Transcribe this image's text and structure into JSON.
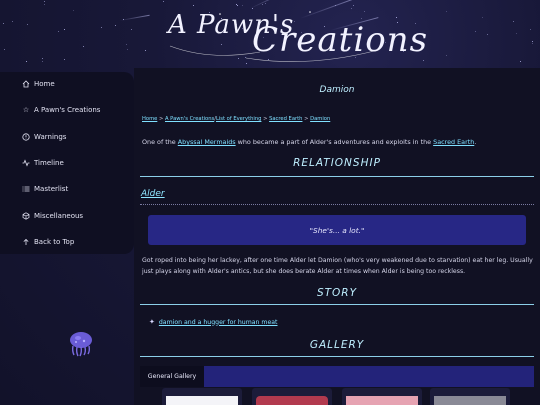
{
  "header": {
    "logo_text_a": "A Pawn's",
    "logo_text_b": "Creations"
  },
  "sidebar": {
    "items": [
      {
        "label": "Home",
        "icon": "home-icon"
      },
      {
        "label": "A Pawn's Creations",
        "icon": "star-outline-icon"
      },
      {
        "label": "Warnings",
        "icon": "warning-circle-icon"
      },
      {
        "label": "Timeline",
        "icon": "activity-icon"
      },
      {
        "label": "Masterlist",
        "icon": "list-icon"
      },
      {
        "label": "Miscellaneous",
        "icon": "cube-icon"
      },
      {
        "label": "Back to Top",
        "icon": "arrow-up-icon"
      }
    ]
  },
  "main": {
    "title": "Damion",
    "breadcrumb": {
      "home": "Home",
      "sep": " > ",
      "creations": "A Pawn's Creations",
      "slash": "/",
      "list": "List of Everything",
      "sacred": "Sacred Earth",
      "current": "Damion"
    },
    "intro": {
      "pre": "One of the ",
      "link1": "Abyssal Mermaids",
      "mid": " who became a part of Alder's adventures and exploits in the ",
      "link2": "Sacred Earth",
      "post": "."
    },
    "relationship_heading": "RELATIONSHIP",
    "relation_name": "Alder",
    "quote": "\"She's... a lot.\"",
    "relation_text": "Got roped into being her lackey, after one time Alder let Damion (who's very weakened due to starvation) eat her leg. Usually just plays along with Alder's antics, but she does berate Alder at times when Alder is being too reckless.",
    "story_heading": "STORY",
    "story_items": [
      "damion and a hugger for human meat"
    ],
    "gallery_heading": "GALLERY",
    "gallery_tab": "General Gallery"
  },
  "colors": {
    "accent_cyan": "#bfefff",
    "link": "#7fe0ff",
    "quote_bg": "#272785",
    "sidebar_bg": "#0f0f22"
  }
}
